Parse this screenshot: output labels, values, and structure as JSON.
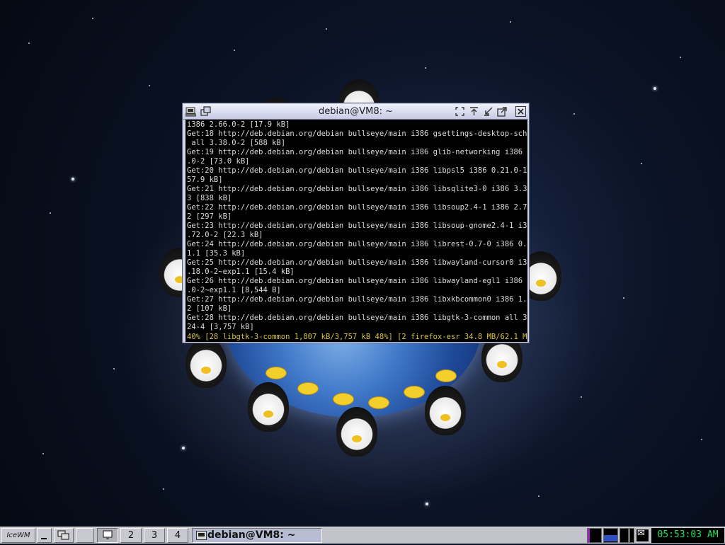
{
  "window": {
    "title": "debian@VM8: ~",
    "terminal_lines": [
      "i386 2.66.0-2 [17.9 kB]",
      "Get:18 http://deb.debian.org/debian bullseye/main i386 gsettings-desktop-schemas",
      " all 3.38.0-2 [588 kB]",
      "Get:19 http://deb.debian.org/debian bullseye/main i386 glib-networking i386 2.66",
      ".0-2 [73.0 kB]",
      "Get:20 http://deb.debian.org/debian bullseye/main i386 libpsl5 i386 0.21.0-1.2 [",
      "57.9 kB]",
      "Get:21 http://deb.debian.org/debian bullseye/main i386 libsqlite3-0 i386 3.34.1-",
      "3 [838 kB]",
      "Get:22 http://deb.debian.org/debian bullseye/main i386 libsoup2.4-1 i386 2.72.0-",
      "2 [297 kB]",
      "Get:23 http://deb.debian.org/debian bullseye/main i386 libsoup-gnome2.4-1 i386 2",
      ".72.0-2 [22.3 kB]",
      "Get:24 http://deb.debian.org/debian bullseye/main i386 librest-0.7-0 i386 0.8.1-",
      "1.1 [35.3 kB]",
      "Get:25 http://deb.debian.org/debian bullseye/main i386 libwayland-cursor0 i386 1",
      ".18.0-2~exp1.1 [15.4 kB]",
      "Get:26 http://deb.debian.org/debian bullseye/main i386 libwayland-egl1 i386 1.18",
      ".0-2~exp1.1 [8,544 B]",
      "Get:27 http://deb.debian.org/debian bullseye/main i386 libxkbcommon0 i386 1.0.3-",
      "2 [107 kB]",
      "Get:28 http://deb.debian.org/debian bullseye/main i386 libgtk-3-common all 3.24.",
      "24-4 [3,757 kB]"
    ],
    "status_line": "40% [28 libgtk-3-common 1,807 kB/3,757 kB 48%] [2 firefox-esr 34.8 MB/62.1 MB 5"
  },
  "taskbar": {
    "start_label": "IceWM",
    "workspaces": [
      "1",
      "2",
      "3",
      "4"
    ],
    "active_workspace": "1",
    "task_label": "debian@VM8: ~",
    "clock": "05:53:03 AM"
  },
  "icons": {
    "titlebar_left": [
      "terminal-menu-icon",
      "restore-window-icon"
    ],
    "titlebar_right": [
      "maximize-vertical-icon",
      "rollup-icon",
      "minimize-icon",
      "maximize-icon",
      "close-icon"
    ],
    "taskbar": [
      "icewm-start-icon",
      "show-desktop-icon",
      "window-list-icon",
      "mail-icon"
    ]
  },
  "colors": {
    "terminal_bg": "#000000",
    "terminal_fg": "#dcdcdc",
    "status_fg": "#d6c23a",
    "clock_fg": "#22dd55",
    "titlebar": "#c7cbe3"
  }
}
